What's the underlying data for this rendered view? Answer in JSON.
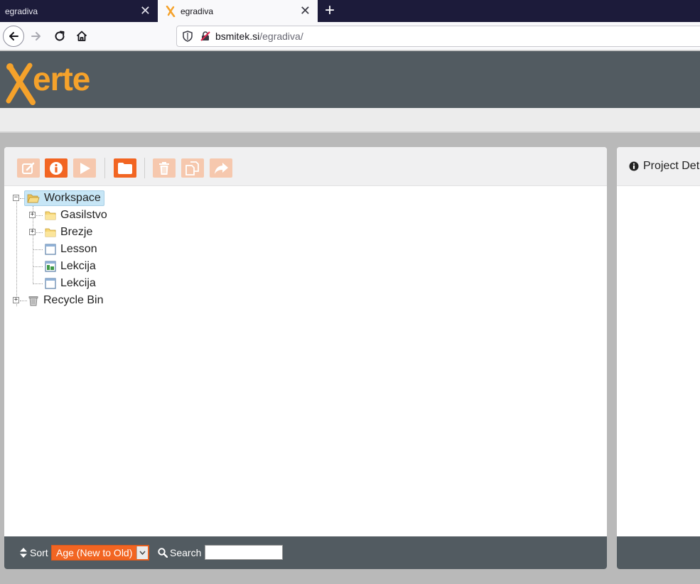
{
  "browser": {
    "tabs": [
      {
        "title": "egradiva",
        "active": false
      },
      {
        "title": "egradiva",
        "active": true
      }
    ],
    "new_tab_symbol": "+",
    "close_symbol": "✕",
    "url_host": "bsmitek.si",
    "url_path": "/egradiva/"
  },
  "header": {
    "logo_text": "erte",
    "brand_color": "#f5a22b",
    "header_color": "#525b61"
  },
  "toolbar": {
    "buttons": [
      {
        "name": "edit",
        "icon": "pencil-icon",
        "enabled": false
      },
      {
        "name": "properties",
        "icon": "info-icon",
        "enabled": true
      },
      {
        "name": "preview",
        "icon": "play-icon",
        "enabled": false
      },
      {
        "name": "new-folder",
        "icon": "folder-icon",
        "enabled": true
      },
      {
        "name": "delete",
        "icon": "trash-icon",
        "enabled": false
      },
      {
        "name": "duplicate",
        "icon": "copy-icon",
        "enabled": false
      },
      {
        "name": "publish",
        "icon": "share-icon",
        "enabled": false
      }
    ],
    "accent": "#f26522"
  },
  "tree": {
    "root": "Workspace",
    "children": [
      {
        "label": "Gasilstvo",
        "type": "folder"
      },
      {
        "label": "Brezje",
        "type": "folder"
      },
      {
        "label": "Lesson",
        "type": "file"
      },
      {
        "label": "Lekcija",
        "type": "file-green"
      },
      {
        "label": "Lekcija",
        "type": "file"
      }
    ],
    "recycle": "Recycle Bin"
  },
  "footer": {
    "sort_label": "Sort",
    "sort_value": "Age (New to Old)",
    "search_label": "Search",
    "search_value": ""
  },
  "details": {
    "title": "Project Det"
  }
}
